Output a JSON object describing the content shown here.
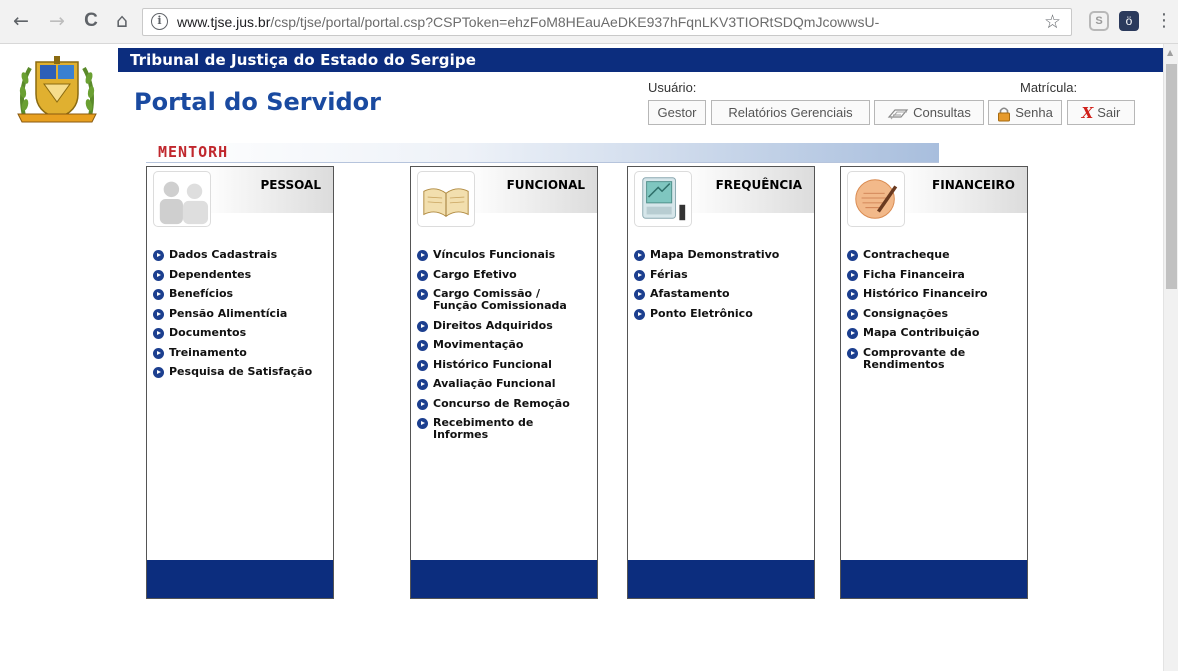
{
  "browser": {
    "url_host": "www.tjse.jus.br",
    "url_path": "/csp/tjse/portal/portal.csp?CSPToken=ehzFoM8HEauAeDKE937hFqnLKV3TIORtSDQmJcowwsU-",
    "back_glyph": "←",
    "forward_glyph": "→",
    "reload_glyph": "C",
    "home_glyph": "⌂",
    "info_glyph": "i",
    "star_glyph": "☆",
    "menu_glyph": "⋮",
    "ext1_glyph": "S",
    "ext2_glyph": "ö"
  },
  "header": {
    "court_name": "Tribunal de Justiça do Estado do Sergipe",
    "portal_title": "Portal do Servidor",
    "usuario_label": "Usuário:",
    "matricula_label": "Matrícula:",
    "buttons": {
      "gestor": "Gestor",
      "relatorios": "Relatórios Gerenciais",
      "consultas": "Consultas",
      "senha": "Senha",
      "sair": "Sair"
    }
  },
  "brand": {
    "mento_logo": "MENTORH"
  },
  "panels": [
    {
      "title": "PESSOAL",
      "icon": "people-icon",
      "items": [
        "Dados Cadastrais",
        "Dependentes",
        "Benefícios",
        "Pensão Alimentícia",
        "Documentos",
        "Treinamento",
        "Pesquisa de Satisfação"
      ]
    },
    {
      "title": "FUNCIONAL",
      "icon": "open-book-icon",
      "items": [
        "Vínculos Funcionais",
        "Cargo Efetivo",
        "Cargo Comissão /\nFunção Comissionada",
        "Direitos Adquiridos",
        "Movimentação",
        "Histórico Funcional",
        "Avaliação Funcional",
        "Concurso de Remoção",
        "Recebimento de\nInformes"
      ]
    },
    {
      "title": "FREQUÊNCIA",
      "icon": "time-clock-icon",
      "items": [
        "Mapa Demonstrativo",
        "Férias",
        "Afastamento",
        "Ponto Eletrônico"
      ]
    },
    {
      "title": "FINANCEIRO",
      "icon": "finance-document-icon",
      "items": [
        "Contracheque",
        "Ficha Financeira",
        "Histórico Financeiro",
        "Consignações",
        "Mapa Contribuição",
        "Comprovante de\nRendimentos"
      ]
    }
  ]
}
